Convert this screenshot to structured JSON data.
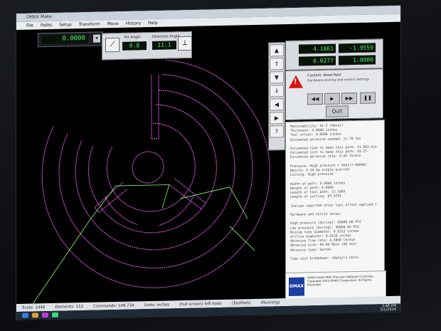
{
  "window": {
    "title": "OMAX Make"
  },
  "menu": {
    "items": [
      "File",
      "Paths",
      "Setup",
      "Transform",
      "Move",
      "History",
      "Help"
    ]
  },
  "readout": {
    "value": "0.0000",
    "button": "▾"
  },
  "angle_panel": {
    "tilt_label": "Tilt Angle",
    "direction_label": "Direction Angle",
    "tilt_value": "0.8",
    "direction_value": "11.1"
  },
  "position": {
    "x": "4.1861",
    "y": "-1.9559",
    "row2_x": "0.0277",
    "row2_y": "1.0000"
  },
  "control_panel": {
    "caution_label": "Caution: Read Rest",
    "warning_text": "Hardware sticking and motion settings",
    "begin_label": "Begin",
    "pause_label": "Pause",
    "quit_label": "Quit"
  },
  "info_text": [
    "Machinability: 91.3 (Metal)",
    "Thickness: 0.0000 inches",
    "Tool offset: 0.0500 inches",
    "Estimated abrasive needed: 11.78 lbs",
    "",
    "Estimated time to make this path: 31.983 min",
    "Estimated cost to make this path: $3.25",
    "Estimated abrasive rate: 0.85 lb/min",
    "",
    "Pressure: High pressure = Small(~40000)",
    "Nozzle: 0.10 mm single pierced",
    "Cutting: High pressure",
    "",
    "Width of path: 8.0000 inches",
    "Height of path: 6.0000",
    "Length of tool path: 72.1885",
    "Length of cutting: 65.5781",
    "",
    "(Values reported after tool offset applied.)",
    "",
    "Hardware and nozzle setup:",
    "",
    "High pressure (during): 50000.00 PSI",
    "Low pressure (during): 50000.00 PSI",
    "Mixing tube diameter: 0.0313 inches",
    "Orifice diameter: 0.0120 inches",
    "Abrasive flow rate: 0.5000 lb/min",
    "Abrasive size: 80.00 Mesh (80 min)",
    "Abrasive type: Garnet",
    "",
    "Time cost breakdown: (Details here)"
  ],
  "omax": {
    "logo": "OMAX",
    "text": "OMAX Intelli-MAX Precision Waterjet Controller. Copyright 2004 OMAX Corporation. All Rights Reserved."
  },
  "status_bar": [
    "Scale: 1448",
    "Elements: 112",
    "Commands: 106,734",
    "Units: inches",
    "(Full screen) left tools",
    "(ToolPath)",
    "(Running)"
  ],
  "clock": {
    "time": "3:46 PM",
    "date": "5/1/2014"
  },
  "colors": {
    "path": "#d254d8",
    "lead": "#8dff6a",
    "readout": "#4cf36b"
  }
}
